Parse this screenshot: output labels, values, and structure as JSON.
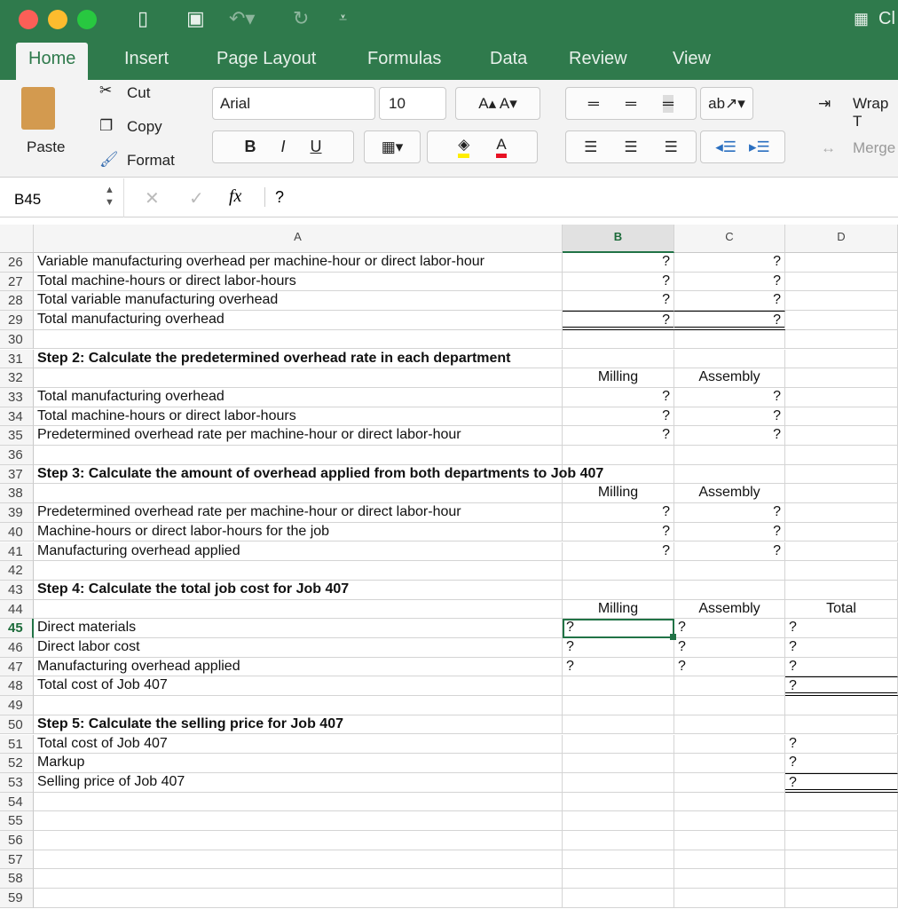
{
  "window": {
    "title_partial": "Cl",
    "lights": [
      "#fc5f57",
      "#fdbc2e",
      "#28c840"
    ]
  },
  "tabs": [
    {
      "label": "Home",
      "active": true
    },
    {
      "label": "Insert"
    },
    {
      "label": "Page Layout"
    },
    {
      "label": "Formulas"
    },
    {
      "label": "Data"
    },
    {
      "label": "Review"
    },
    {
      "label": "View"
    }
  ],
  "ribbon": {
    "paste": "Paste",
    "cut": "Cut",
    "copy": "Copy",
    "format": "Format",
    "font": "Arial",
    "size": "10",
    "bold": "B",
    "italic": "I",
    "underline": "U",
    "wrap": "Wrap T",
    "merge": "Merge",
    "fill_color": "#ffee00",
    "font_color": "#e81123"
  },
  "formula_bar": {
    "name_box": "B45",
    "fx": "fx",
    "value": "?"
  },
  "columns": [
    "A",
    "B",
    "C",
    "D"
  ],
  "selected": {
    "col": "B",
    "row": 45
  },
  "rows": [
    {
      "n": 26,
      "a": "Variable manufacturing overhead per machine-hour or direct labor-hour",
      "b": "?",
      "c": "?"
    },
    {
      "n": 27,
      "a": "Total machine-hours or direct labor-hours",
      "b": "?",
      "c": "?"
    },
    {
      "n": 28,
      "a": "Total variable manufacturing overhead",
      "b": "?",
      "c": "?"
    },
    {
      "n": 29,
      "a": "Total manufacturing overhead",
      "b": "?",
      "c": "?"
    },
    {
      "n": 30
    },
    {
      "n": 31,
      "a": "Step 2: Calculate the predetermined overhead rate in each department",
      "bold": true
    },
    {
      "n": 32,
      "b": "Milling",
      "c": "Assembly"
    },
    {
      "n": 33,
      "a": "Total manufacturing overhead",
      "b": "?",
      "c": "?"
    },
    {
      "n": 34,
      "a": "Total machine-hours or direct labor-hours",
      "b": "?",
      "c": "?"
    },
    {
      "n": 35,
      "a": "Predetermined overhead rate per machine-hour or direct labor-hour",
      "b": "?",
      "c": "?"
    },
    {
      "n": 36
    },
    {
      "n": 37,
      "a": "Step 3: Calculate the amount of overhead applied from both departments to Job 407",
      "bold": true
    },
    {
      "n": 38,
      "b": "Milling",
      "c": "Assembly"
    },
    {
      "n": 39,
      "a": "Predetermined overhead rate per machine-hour or direct labor-hour",
      "b": "?",
      "c": "?"
    },
    {
      "n": 40,
      "a": "Machine-hours or direct labor-hours for the job",
      "b": "?",
      "c": "?"
    },
    {
      "n": 41,
      "a": "Manufacturing overhead applied",
      "b": "?",
      "c": "?"
    },
    {
      "n": 42
    },
    {
      "n": 43,
      "a": "Step 4: Calculate the total job cost for Job 407",
      "bold": true
    },
    {
      "n": 44,
      "b": "Milling",
      "c": "Assembly",
      "d": "Total"
    },
    {
      "n": 45,
      "a": "Direct materials",
      "b": "?",
      "c": "?",
      "d": "?"
    },
    {
      "n": 46,
      "a": "Direct labor cost",
      "b": "?",
      "c": "?",
      "d": "?"
    },
    {
      "n": 47,
      "a": "Manufacturing overhead applied",
      "b": "?",
      "c": "?",
      "d": "?"
    },
    {
      "n": 48,
      "a": "Total cost of Job 407",
      "d": "?"
    },
    {
      "n": 49
    },
    {
      "n": 50,
      "a": "Step 5: Calculate the selling price for Job 407",
      "bold": true
    },
    {
      "n": 51,
      "a": "Total cost of Job 407",
      "d": "?"
    },
    {
      "n": 52,
      "a": "Markup",
      "d": "?"
    },
    {
      "n": 53,
      "a": "Selling price of Job 407",
      "d": "?"
    },
    {
      "n": 54
    },
    {
      "n": 55
    },
    {
      "n": 56
    },
    {
      "n": 57
    },
    {
      "n": 58
    },
    {
      "n": 59
    }
  ]
}
